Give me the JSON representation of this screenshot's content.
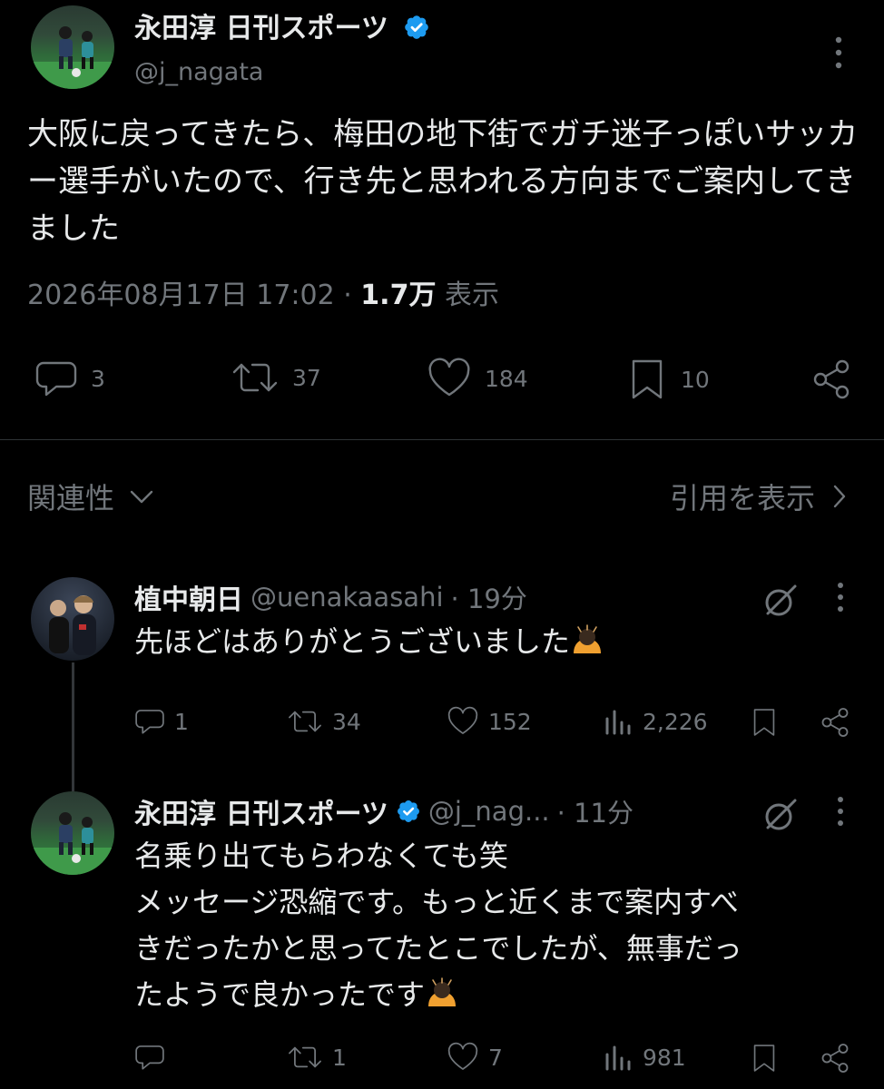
{
  "main_tweet": {
    "author_name": "永田淳 日刊スポーツ",
    "handle": "@j_nagata",
    "text": "大阪に戻ってきたら、梅田の地下街でガチ迷子っぽいサッカー選手がいたので、行き先と思われる方向までご案内してきました",
    "timestamp": "2026年08月17日 17:02",
    "separator": " · ",
    "views": "1.7万",
    "views_label": "表示",
    "stats": {
      "replies": "3",
      "retweets": "37",
      "likes": "184",
      "bookmarks": "10"
    }
  },
  "replies_header": {
    "sort_label": "関連性",
    "quotes_link": "引用を表示"
  },
  "replies": [
    {
      "author_name": "植中朝日",
      "handle": "@uenakaasahi",
      "time": "· 19分",
      "text": "先ほどはありがとうございました",
      "stats": {
        "replies": "1",
        "retweets": "34",
        "likes": "152",
        "views": "2,226"
      }
    },
    {
      "author_name": "永田淳 日刊スポーツ",
      "handle": "@j_nag...",
      "time": "· 11分",
      "lines": [
        "名乗り出てもらわなくても笑",
        "メッセージ恐縮です。もっと近くまで案内すべ",
        "きだったかと思ってたとこでしたが、無事だっ",
        "たようで良かったです"
      ],
      "stats": {
        "replies": "",
        "retweets": "1",
        "likes": "7",
        "views": "981"
      }
    }
  ],
  "colors": {
    "background": "#000000",
    "text": "#e7e9ea",
    "muted": "#71767b",
    "verified": "#1d9bf0",
    "divider": "#2f3336"
  }
}
